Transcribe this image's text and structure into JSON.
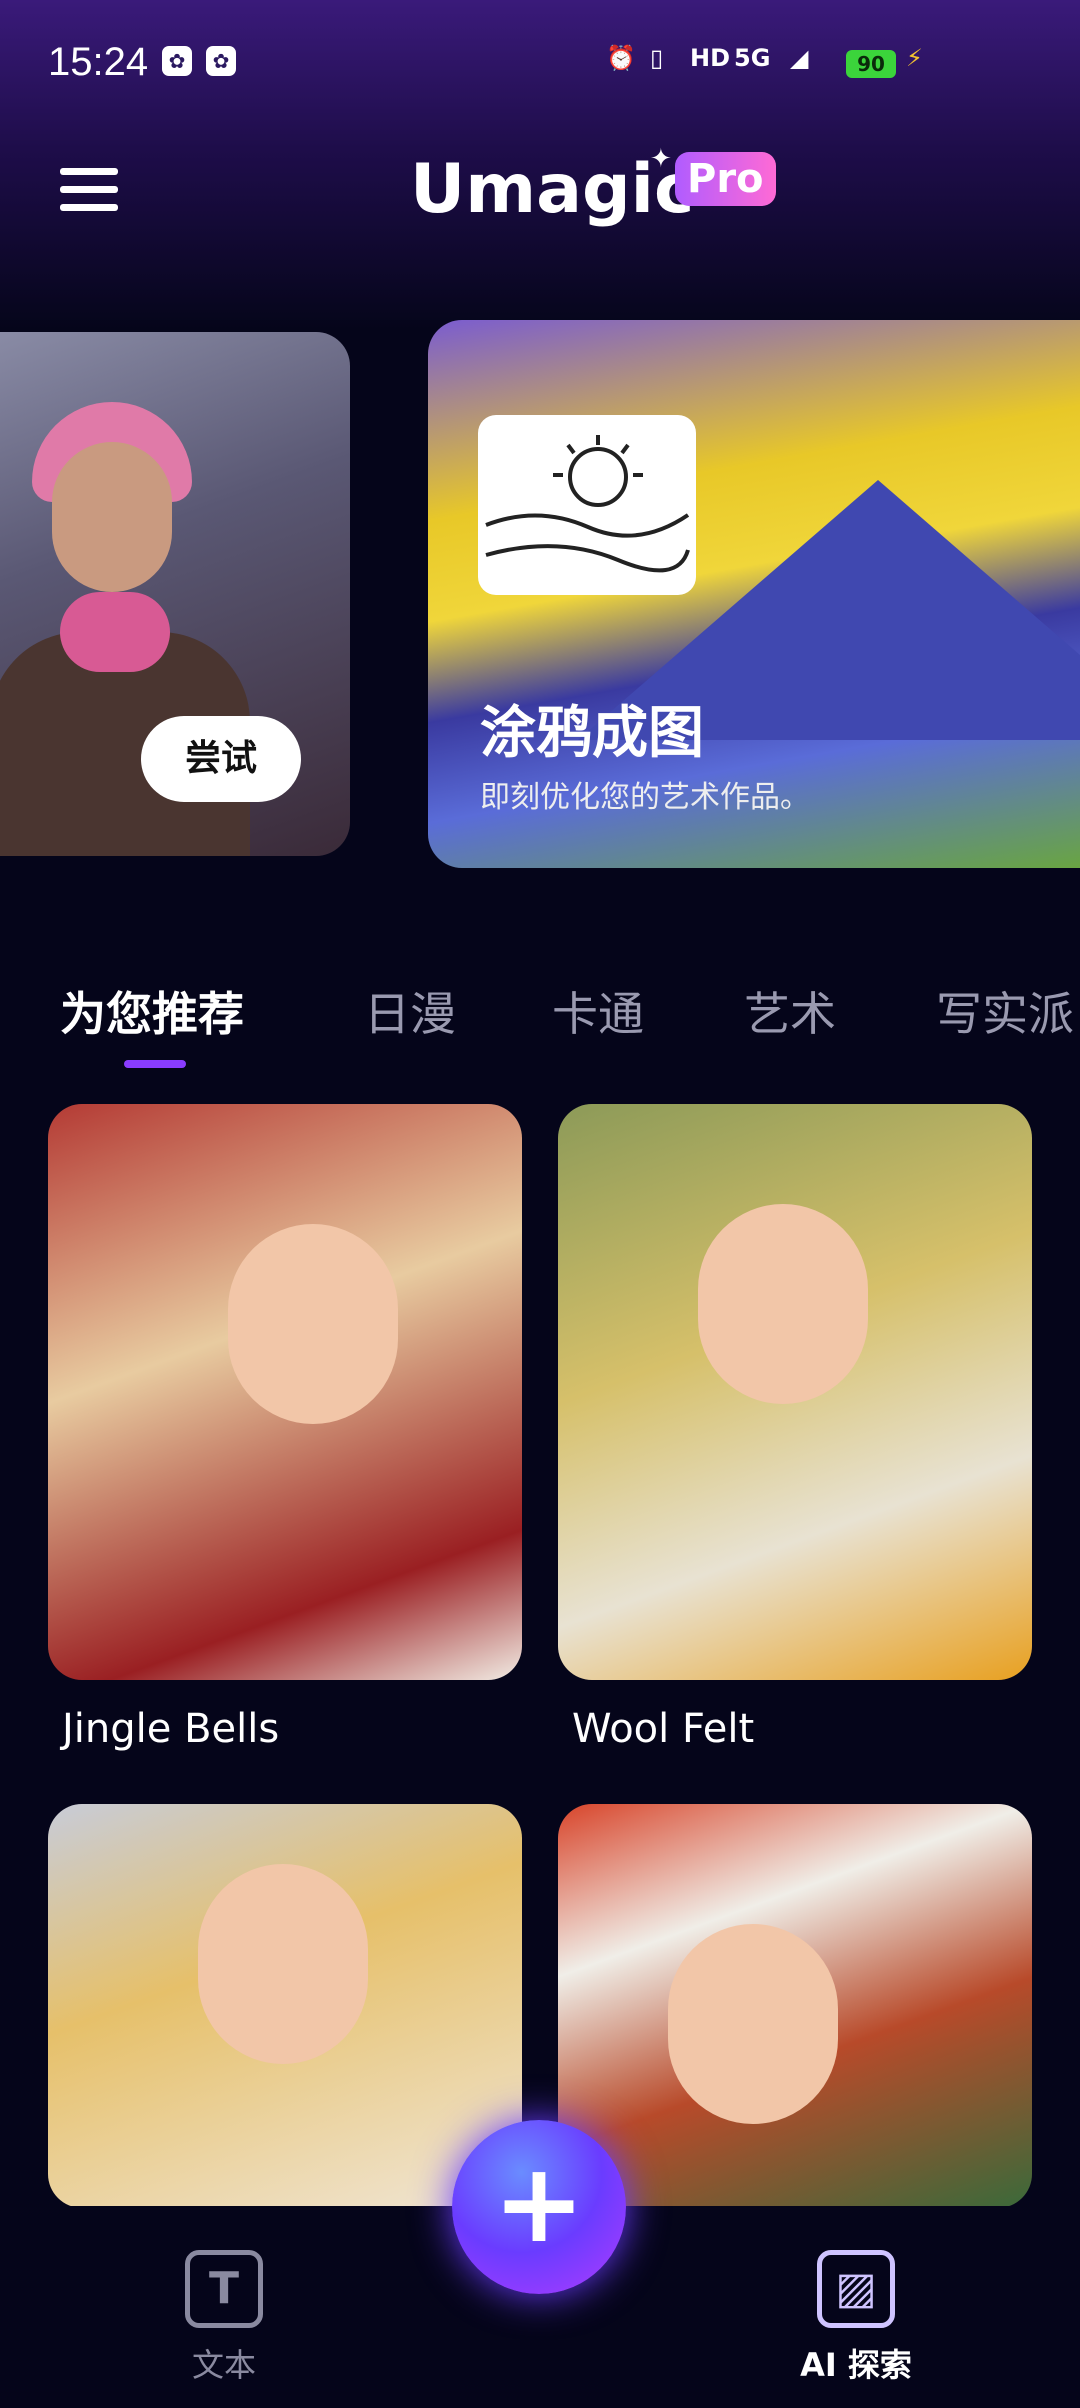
{
  "status_bar": {
    "time": "15:24",
    "network": "5G",
    "hd": "HD",
    "battery": "90"
  },
  "header": {
    "logo": "Umagic",
    "badge": "Pro"
  },
  "banners": [
    {
      "button": "尝试"
    },
    {
      "title": "涂鸦成图",
      "subtitle": "即刻优化您的艺术作品。"
    }
  ],
  "tabs": [
    "为您推荐",
    "日漫",
    "卡通",
    "艺术",
    "写实派"
  ],
  "cards": [
    {
      "caption": "Jingle Bells"
    },
    {
      "caption": "Wool Felt"
    },
    {
      "caption": ""
    },
    {
      "caption": ""
    }
  ],
  "bottom_nav": {
    "text_label": "文本",
    "fab": "+",
    "explore_label": "AI 探索"
  }
}
